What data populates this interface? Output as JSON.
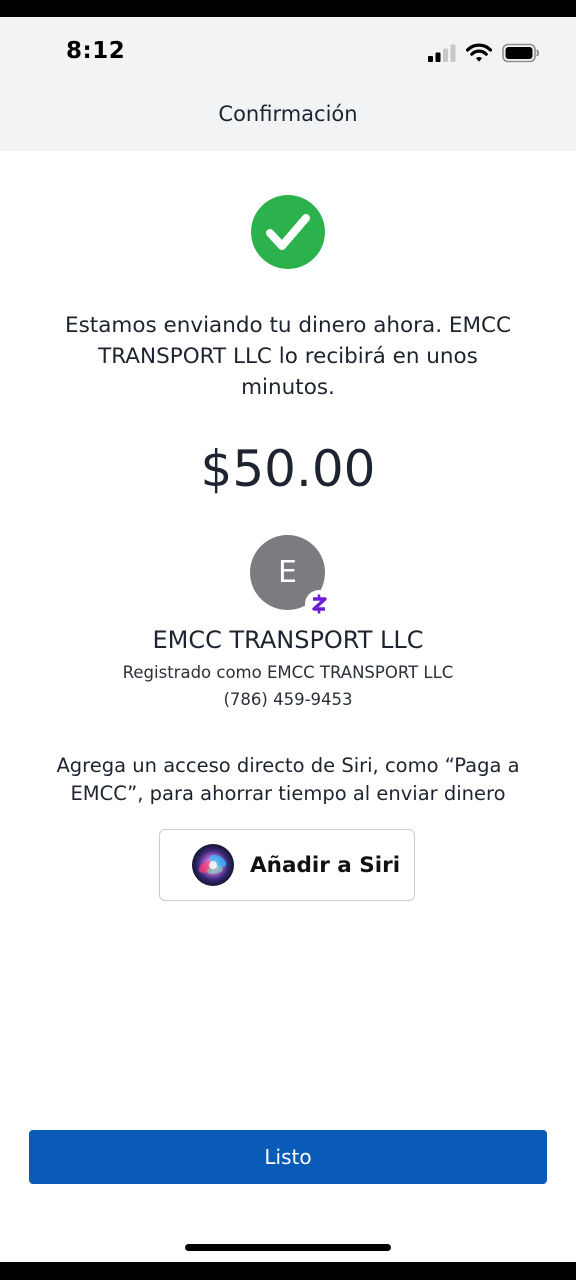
{
  "status_bar": {
    "time": "8:12",
    "icons": [
      "cellular-signal-icon",
      "wifi-icon",
      "battery-icon"
    ]
  },
  "header": {
    "title": "Confirmación"
  },
  "confirmation": {
    "icon": "checkmark-icon",
    "message": "Estamos enviando tu dinero ahora. EMCC TRANSPORT LLC lo recibirá en unos minutos.",
    "amount": "$50.00"
  },
  "recipient": {
    "avatar_initial": "E",
    "badge_icon": "zelle-icon",
    "name": "EMCC TRANSPORT LLC",
    "registered_as": "Registrado como EMCC TRANSPORT LLC",
    "phone": "(786) 459-9453"
  },
  "siri": {
    "prompt": "Agrega un acceso directo de Siri, como “Paga a EMCC”, para ahorrar tiempo al enviar dinero",
    "button_label": "Añadir a Siri",
    "icon": "siri-icon"
  },
  "footer": {
    "done_label": "Listo"
  },
  "colors": {
    "success_green": "#2bb24c",
    "primary_blue": "#0a5bb8",
    "zelle_purple": "#6d1ed4",
    "avatar_gray": "#7a7c80"
  }
}
